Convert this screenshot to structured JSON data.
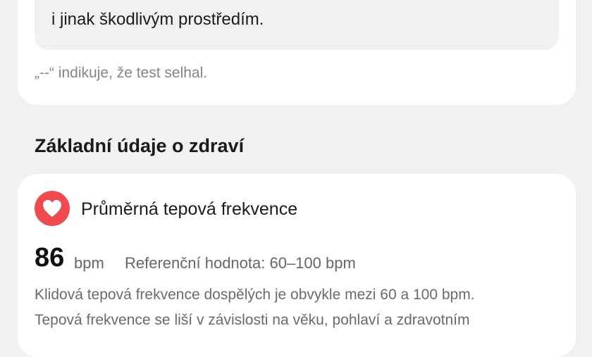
{
  "top_card": {
    "tip_line_1": "",
    "tip_line_2": "i jinak škodlivým prostředím.",
    "fail_note": "„--“ indikuje, že test selhal."
  },
  "section": {
    "title": "Základní údaje o zdraví"
  },
  "heart_rate_card": {
    "icon": "heart-icon",
    "title": "Průměrná tepová frekvence",
    "value": "86",
    "unit": "bpm",
    "reference": "Referenční hodnota: 60–100 bpm",
    "description_line_1": "Klidová tepová frekvence dospělých je obvykle mezi 60 a 100 bpm.",
    "description_line_2": "Tepová frekvence se liší v závislosti na věku, pohlaví a zdravotním"
  },
  "colors": {
    "page_bg": "#f1f1f3",
    "card_bg": "#ffffff",
    "heart_red": "#ef4a4f"
  }
}
